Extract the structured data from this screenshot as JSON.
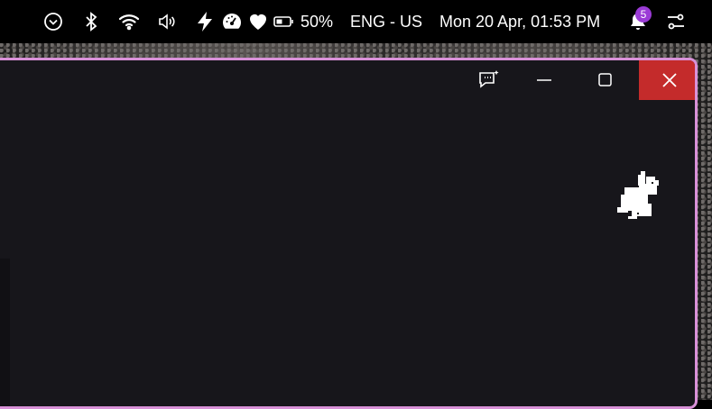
{
  "topbar": {
    "battery_percent": "50%",
    "language": "ENG - US",
    "datetime": "Mon 20 Apr, 01:53 PM",
    "notification_count": "5",
    "icons": [
      "chevron-circle-icon",
      "bluetooth-icon",
      "wifi-icon",
      "volume-icon",
      "bolt-icon",
      "gauge-icon",
      "heart-icon",
      "battery-icon",
      "bell-icon",
      "settings-sliders-icon"
    ]
  },
  "window": {
    "border_color": "#d991d8",
    "background": "#17161b",
    "close_color": "#c42b2b",
    "buttons": [
      "feedback-icon",
      "minimize-icon",
      "maximize-icon",
      "close-icon"
    ]
  }
}
